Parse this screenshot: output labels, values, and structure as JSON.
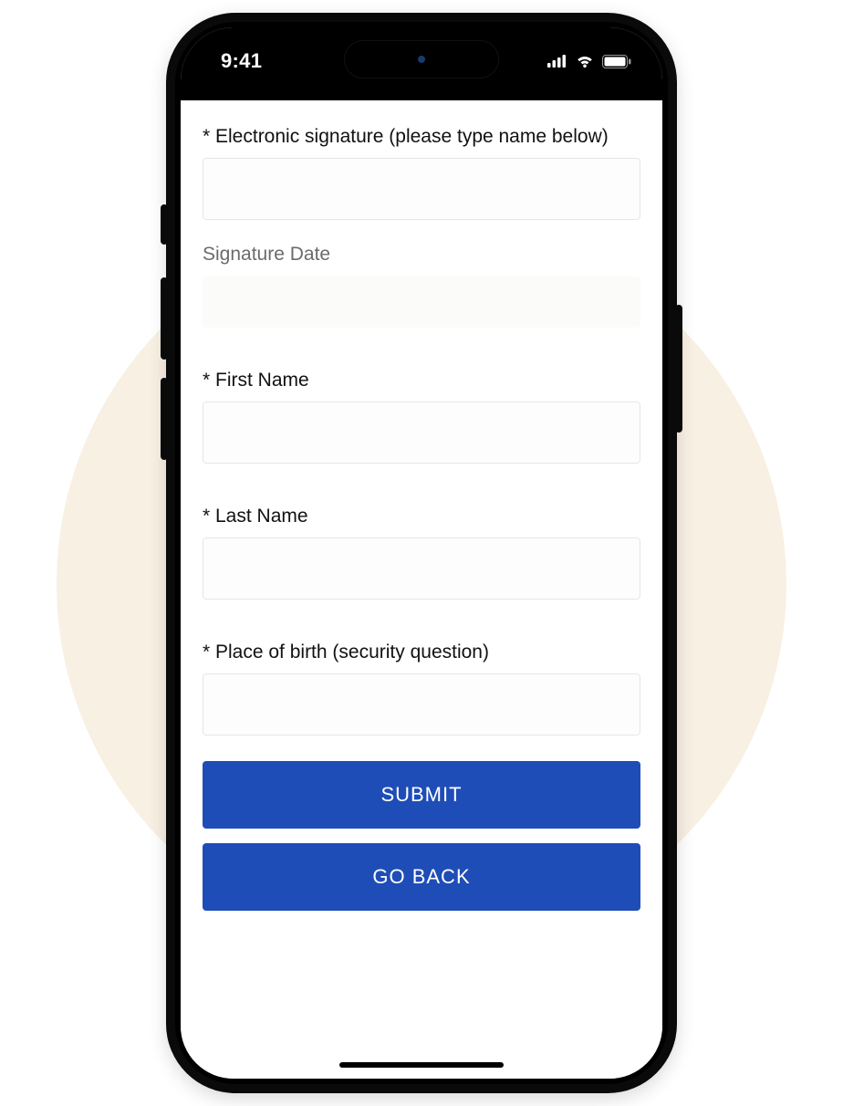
{
  "status": {
    "time": "9:41"
  },
  "form": {
    "esign_label": "* Electronic signature (please type name below)",
    "esign_value": "",
    "sigdate_label": "Signature Date",
    "sigdate_value": "",
    "first_label": "* First Name",
    "first_value": "",
    "last_label": "* Last Name",
    "last_value": "",
    "pob_label": "* Place of birth (security question)",
    "pob_value": ""
  },
  "buttons": {
    "submit_label": "SUBMIT",
    "back_label": "GO BACK"
  }
}
